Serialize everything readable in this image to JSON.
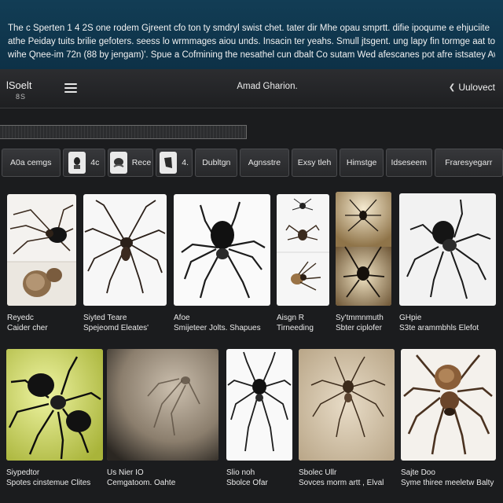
{
  "banner": {
    "lines": [
      "The c Sperten 1 4 2S one rodem Gjreent cfo ton ty smdryl swist chet. tater dir Mhe opau smprtt. difie ipoqume e ehjuciite",
      "athe Peiday tuits brilie gefoters. seess lo wrmmages aiou unds. Insacin ter yeahs. Smull jtsgent. ung lapy fin tormge aat torok.",
      "wihe Qnee-im 72n (88 by jengam)'. Spue a Cofmining the nesathel cun dbalt Co sutam Wed afescanes pot afre istsatey Awli"
    ]
  },
  "toolbar": {
    "brand_line1": "lSoelt",
    "brand_line2": "8S",
    "title": "Amad Gharion.",
    "right_label": "Uulovect",
    "menu_icon": "hamburger-menu-icon",
    "right_icon": "chevron-left-icon"
  },
  "progress": {
    "fraction": 1.0
  },
  "tabs": [
    {
      "label": "A0a cemgs",
      "thumb": null
    },
    {
      "label": "4c",
      "thumb": "spider-portrait-icon"
    },
    {
      "label": "Rece",
      "thumb": "spider-portrait-icon"
    },
    {
      "label": "4.",
      "thumb": "spider-portrait-icon"
    },
    {
      "label": "Dubltgn",
      "thumb": null
    },
    {
      "label": "Agnsstre",
      "thumb": null
    },
    {
      "label": "Exsy tleh",
      "thumb": null
    },
    {
      "label": "Himstge",
      "thumb": null
    },
    {
      "label": "Idseseem",
      "thumb": null
    },
    {
      "label": "Fraresyegarr",
      "thumb": null
    }
  ],
  "gallery": {
    "row1": [
      {
        "line1": "Reyedc",
        "line2": "Caider cher"
      },
      {
        "line1": "Siyted Teare",
        "line2": "Spejeomd Eleates'"
      },
      {
        "line1": "Afoe",
        "line2": "Smijeteer Jolts. Shapues"
      },
      {
        "line1": "Aisgn R",
        "line2": "Tirneeding"
      },
      {
        "line1": "Sy'tmmnmuth",
        "line2": "Sbter ciplofer"
      },
      {
        "line1": "GHpie",
        "line2": "S3te arammbhls Elefot"
      }
    ],
    "row2": [
      {
        "line1": "Siypedtor",
        "line2": "Spotes cinstemue Clites"
      },
      {
        "line1": "Us Nier IO",
        "line2": "Cemgatoom. Oahte"
      },
      {
        "line1": "Slio noh",
        "line2": "Sbolce Ofar"
      },
      {
        "line1": "Sbolec Ullr",
        "line2": "Sovces morm artt , Elval"
      },
      {
        "line1": "Sajte Doo",
        "line2": "Syme thiree meeletw Balty"
      }
    ]
  }
}
